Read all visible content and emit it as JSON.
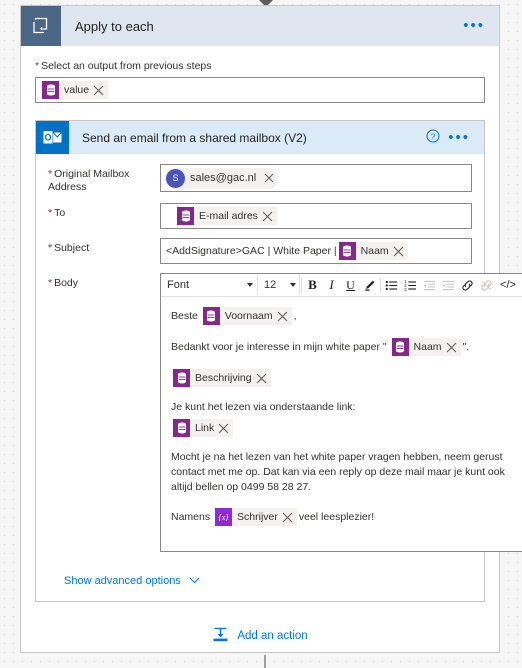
{
  "colors": {
    "accent_blue": "#0078d4",
    "loop_icon_bg": "#4a6785",
    "loop_header_bg": "#dfe6ef",
    "outlook_icon_bg": "#0072c6",
    "action_header_bg": "#dbeaf7",
    "token_purple": "#86278b",
    "variable_purple": "#8f2bd4",
    "avatar_blue": "#4b53bc",
    "required_red": "#a4262c"
  },
  "foreach": {
    "title": "Apply to each",
    "icon": "loop-icon",
    "menu_icon": "ellipsis-icon",
    "select_output": {
      "label": "Select an output from previous steps",
      "required_marker": "*",
      "token": {
        "icon": "dynamic-content-icon",
        "label": "value",
        "remove_icon": "close-icon"
      }
    }
  },
  "action": {
    "title": "Send an email from a shared mailbox (V2)",
    "icon": "outlook-icon",
    "help_icon": "help-circle-icon",
    "menu_icon": "ellipsis-icon",
    "fields": {
      "mailbox": {
        "label": "Original Mailbox Address",
        "required_marker": "*",
        "person": {
          "initial": "S",
          "label": "sales@gac.nl",
          "remove_icon": "close-icon"
        }
      },
      "to": {
        "label": "To",
        "required_marker": "*",
        "token": {
          "icon": "dynamic-content-icon",
          "label": "E-mail adres",
          "remove_icon": "close-icon"
        }
      },
      "subject": {
        "label": "Subject",
        "required_marker": "*",
        "text_before": "<AddSignature>GAC | White Paper |",
        "token": {
          "icon": "dynamic-content-icon",
          "label": "Naam",
          "remove_icon": "close-icon"
        }
      },
      "body": {
        "label": "Body",
        "required_marker": "*"
      }
    },
    "toolbar": {
      "font_label": "Font",
      "font_caret": "chevron-down-icon",
      "size_label": "12",
      "size_caret": "chevron-down-icon",
      "bold": "B",
      "italic": "I",
      "underline": "U",
      "highlight_icon": "highlighter-icon",
      "bulleted_list_icon": "bulleted-list-icon",
      "numbered_list_icon": "numbered-list-icon",
      "outdent_icon": "outdent-icon",
      "indent_icon": "indent-icon",
      "link_icon": "link-icon",
      "unlink_icon": "unlink-icon",
      "code_icon": "code-icon",
      "code_label": "</>"
    },
    "body_content": {
      "line1_prefix": "Beste",
      "line1_token": {
        "label": "Voornaam",
        "remove_icon": "close-icon"
      },
      "line1_suffix": ",",
      "line2_prefix": "Bedankt voor je interesse in mijn white paper \"",
      "line2_token": {
        "label": "Naam",
        "remove_icon": "close-icon"
      },
      "line2_suffix": "\".",
      "line3_token": {
        "label": "Beschrijving",
        "remove_icon": "close-icon"
      },
      "line4_text": "Je kunt het lezen via onderstaande link:",
      "line5_token": {
        "label": "Link",
        "remove_icon": "close-icon"
      },
      "line6_text": "Mocht je na het lezen van het white paper vragen hebben, neem gerust contact met me op. Dat kan via een reply op deze mail maar je kunt ook altijd bellen op 0499 58 28 27.",
      "line7_prefix": "Namens",
      "line7_token": {
        "icon": "variable-icon",
        "glyph": "{x}",
        "label": "Schrijver",
        "remove_icon": "close-icon"
      },
      "line7_suffix": "veel leesplezier!"
    },
    "advanced_options": {
      "label": "Show advanced options",
      "caret_icon": "chevron-down-icon"
    }
  },
  "add_action": {
    "label": "Add an action",
    "icon": "add-action-icon"
  }
}
